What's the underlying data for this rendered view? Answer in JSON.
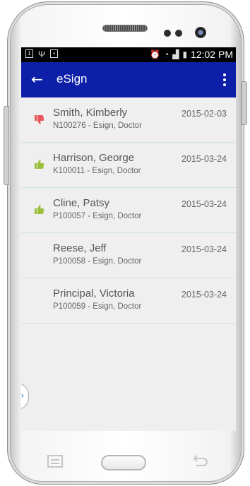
{
  "status_bar": {
    "time": "12:02 PM"
  },
  "app_bar": {
    "title": "eSign",
    "back_symbol": "←"
  },
  "icons": {
    "thumbs_down_color": "#e9575a",
    "thumbs_up_color": "#9bc13c",
    "app_bar_color": "#0d1fa8"
  },
  "rows": [
    {
      "name": "Smith, Kimberly",
      "subtitle": "N100276 - Esign, Doctor",
      "date": "2015-02-03",
      "status_icon": "thumbs-down-icon"
    },
    {
      "name": "Harrison, George",
      "subtitle": "K100011 - Esign, Doctor",
      "date": "2015-03-24",
      "status_icon": "thumbs-up-icon"
    },
    {
      "name": "Cline, Patsy",
      "subtitle": "P100057 - Esign, Doctor",
      "date": "2015-03-24",
      "status_icon": "thumbs-up-icon"
    },
    {
      "name": "Reese, Jeff",
      "subtitle": "P100058 - Esign, Doctor",
      "date": "2015-03-24",
      "status_icon": ""
    },
    {
      "name": "Principal, Victoria",
      "subtitle": "P100059 - Esign, Doctor",
      "date": "2015-03-24",
      "status_icon": ""
    }
  ],
  "drawer": {
    "symbol": "›"
  }
}
